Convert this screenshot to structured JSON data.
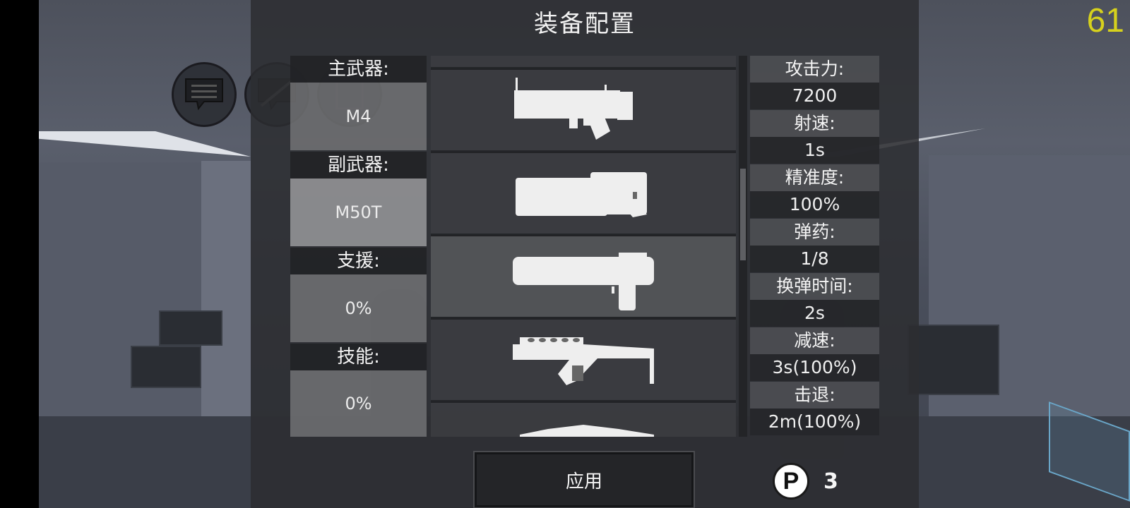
{
  "title": "装备配置",
  "fps": "61",
  "slots": [
    {
      "label": "主武器:",
      "value": "M4"
    },
    {
      "label": "副武器:",
      "value": "M50T"
    },
    {
      "label": "支援:",
      "value": "0%"
    },
    {
      "label": "技能:",
      "value": "0%"
    }
  ],
  "weapons": [
    {
      "icon": "grenade-launcher-icon"
    },
    {
      "icon": "heavy-cannon-icon"
    },
    {
      "icon": "shotgun-icon"
    },
    {
      "icon": "smg-vector-icon"
    },
    {
      "icon": "rifle-partial-icon"
    }
  ],
  "stats": [
    {
      "label": "攻击力:",
      "value": "7200"
    },
    {
      "label": "射速:",
      "value": "1s"
    },
    {
      "label": "精准度:",
      "value": "100%"
    },
    {
      "label": "弹药:",
      "value": "1/8"
    },
    {
      "label": "换弹时间:",
      "value": "2s"
    },
    {
      "label": "减速:",
      "value": "3s(100%)"
    },
    {
      "label": "击退:",
      "value": "2m(100%)"
    }
  ],
  "apply_label": "应用",
  "points": {
    "icon_letter": "P",
    "count": "3"
  },
  "colors": {
    "fps": "#d6d11d",
    "panel": "#2c2d31",
    "selected_row": "#5f6064"
  }
}
